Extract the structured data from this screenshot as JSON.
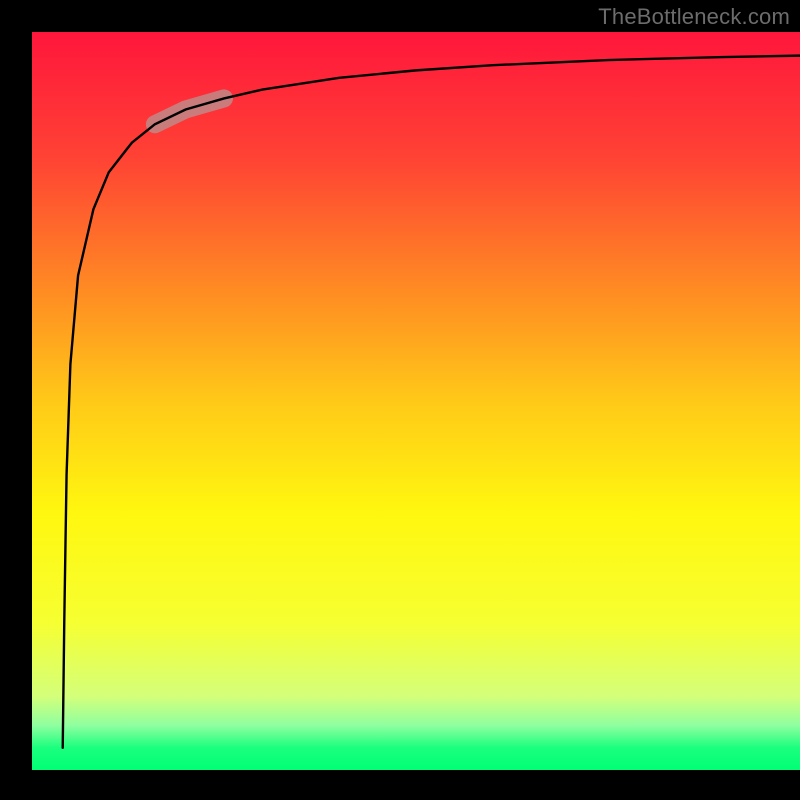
{
  "watermark": "TheBottleneck.com",
  "chart_data": {
    "type": "line",
    "title": "",
    "xlabel": "",
    "ylabel": "",
    "xlim": [
      0,
      100
    ],
    "ylim": [
      0,
      100
    ],
    "series": [
      {
        "name": "curve",
        "x": [
          4,
          4.2,
          4.5,
          5,
          6,
          8,
          10,
          13,
          16,
          20,
          25,
          30,
          40,
          50,
          60,
          75,
          90,
          100
        ],
        "y": [
          3,
          20,
          40,
          55,
          67,
          76,
          81,
          85,
          87.5,
          89.5,
          91,
          92.2,
          93.8,
          94.8,
          95.5,
          96.2,
          96.6,
          96.8
        ]
      }
    ],
    "highlight_segment": {
      "x_range": [
        16,
        26
      ],
      "color": "#c08a87"
    },
    "background_gradient": {
      "stops": [
        {
          "offset": 0.0,
          "color": "#ff163c"
        },
        {
          "offset": 0.17,
          "color": "#ff4234"
        },
        {
          "offset": 0.35,
          "color": "#ff8b23"
        },
        {
          "offset": 0.5,
          "color": "#ffc918"
        },
        {
          "offset": 0.65,
          "color": "#fff70f"
        },
        {
          "offset": 0.8,
          "color": "#f6ff31"
        },
        {
          "offset": 0.9,
          "color": "#d4ff7a"
        },
        {
          "offset": 0.94,
          "color": "#8effa0"
        },
        {
          "offset": 0.97,
          "color": "#1aff7e"
        },
        {
          "offset": 1.0,
          "color": "#00ff74"
        }
      ]
    }
  }
}
